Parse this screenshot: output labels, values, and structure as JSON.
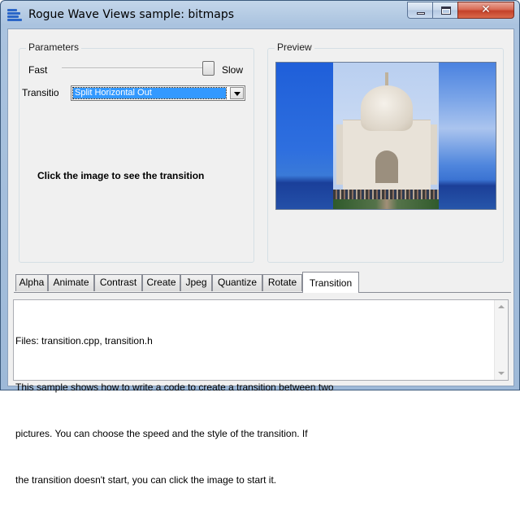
{
  "window": {
    "title": "Rogue Wave Views sample: bitmaps",
    "app_icon": "rogue-wave-app-icon",
    "close_glyph": "✕"
  },
  "parameters": {
    "legend": "Parameters",
    "speed_fast_label": "Fast",
    "speed_slow_label": "Slow",
    "speed_value_fraction": 1.0,
    "transition_label": "Transitio",
    "transition_selected": "Split Horizontal Out",
    "hint": "Click the image to see the transition"
  },
  "preview": {
    "legend": "Preview"
  },
  "tabs": [
    {
      "label": "Alpha",
      "active": false
    },
    {
      "label": "Animate",
      "active": false
    },
    {
      "label": "Contrast",
      "active": false
    },
    {
      "label": "Create",
      "active": false
    },
    {
      "label": "Jpeg",
      "active": false
    },
    {
      "label": "Quantize",
      "active": false
    },
    {
      "label": "Rotate",
      "active": false
    },
    {
      "label": "Transition",
      "active": true
    }
  ],
  "description": {
    "lines": [
      "Files: transition.cpp, transition.h",
      "This sample shows how to write a code to create a transition between two",
      "pictures. You can choose the speed and the style of the transition. If",
      "the transition doesn't start, you can click the image to start it."
    ]
  },
  "colors": {
    "selection": "#3399ff",
    "close_button": "#c4412a"
  }
}
